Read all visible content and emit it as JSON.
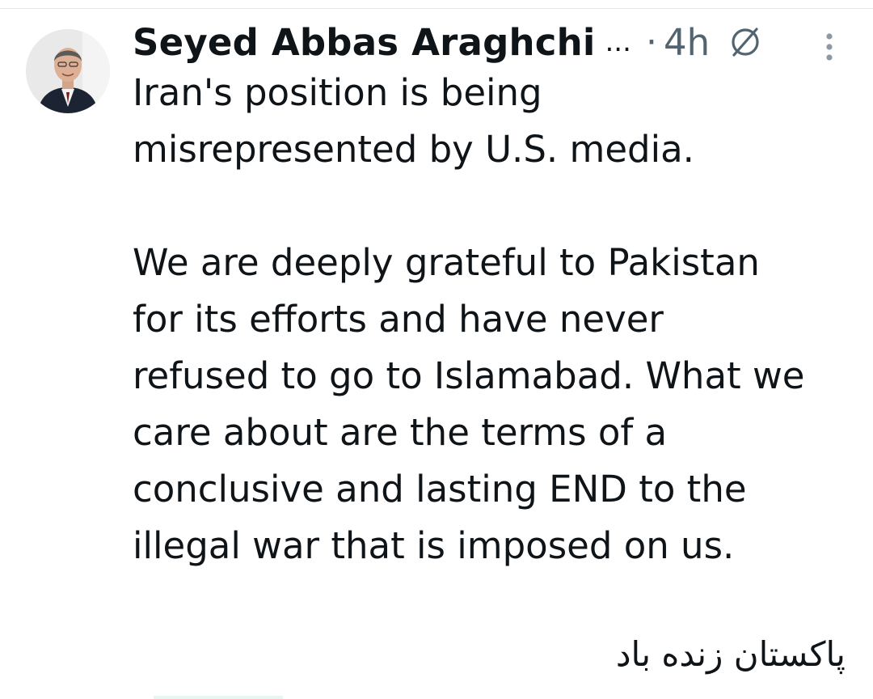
{
  "tweet": {
    "display_name": "Seyed Abbas Araghchi",
    "name_truncation": "...",
    "separator": "·",
    "time_ago": "4h",
    "icons": {
      "automated": "automated-account-icon",
      "more": "more-options-icon"
    },
    "paragraphs": [
      [
        "Iran's position is being",
        "misrepresented by U.S. media."
      ],
      [
        "We are deeply grateful to Pakistan",
        "for its efforts and have never",
        "refused to go to Islamabad. What we",
        "care about are the terms of a",
        "conclusive and lasting END to the",
        "illegal war that is imposed on us."
      ]
    ],
    "urdu_line": "پاکستان زنده باد"
  },
  "colors": {
    "text": "#0f1419",
    "secondary": "#536471",
    "background": "#ffffff"
  }
}
